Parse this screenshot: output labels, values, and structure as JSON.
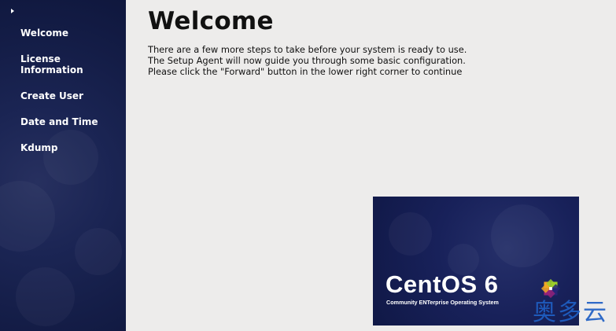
{
  "sidebar": {
    "steps": [
      {
        "label": "Welcome",
        "current": true
      },
      {
        "label": "License\nInformation",
        "current": false
      },
      {
        "label": "Create User",
        "current": false
      },
      {
        "label": "Date and Time",
        "current": false
      },
      {
        "label": "Kdump",
        "current": false
      }
    ]
  },
  "main": {
    "title": "Welcome",
    "paragraph_lines": [
      "There are a few more steps to take before your system is ready to use.",
      "The Setup Agent will now guide you through some basic configuration.",
      "Please click the \"Forward\" button in the lower right corner to continue"
    ]
  },
  "logo": {
    "brand": "CentOS 6",
    "tagline": "Community ENTerprise Operating System",
    "emblem_icon": "centos-emblem-icon"
  },
  "watermark": {
    "text": "奥多云"
  },
  "colors": {
    "sidebar_bg": "#141d47",
    "content_bg": "#edeceb",
    "logo_bg": "#18215a",
    "watermark": "#1f5fc4"
  }
}
